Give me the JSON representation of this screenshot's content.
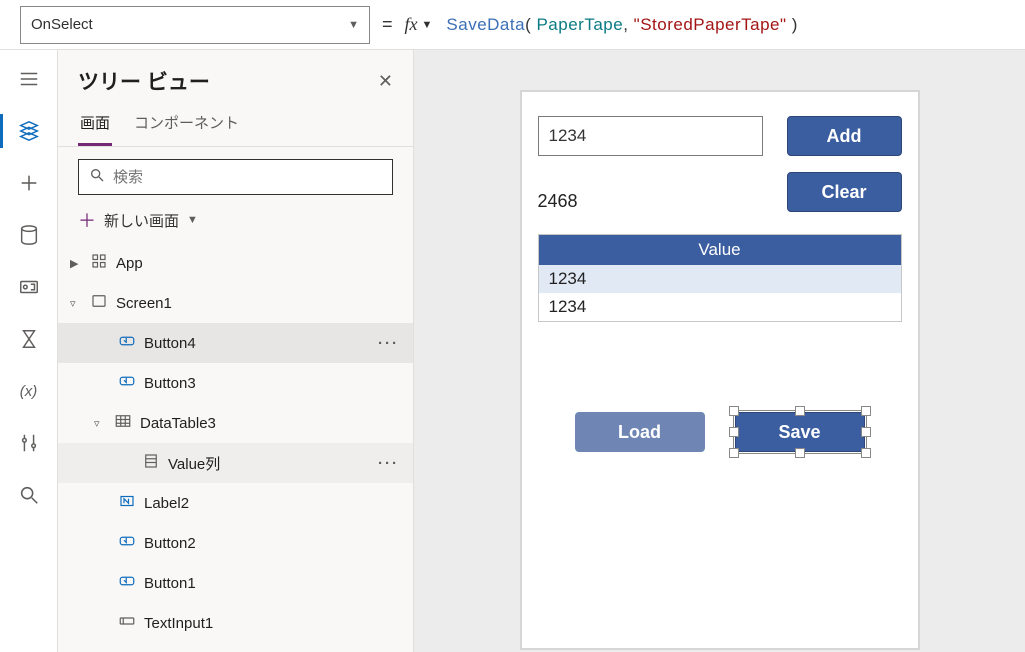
{
  "topbar": {
    "property": "OnSelect",
    "equals": "=",
    "fx": "fx",
    "formula_fn": "SaveData",
    "formula_ident": "PaperTape",
    "formula_str": "\"StoredPaperTape\""
  },
  "treePane": {
    "title": "ツリー ビュー",
    "tabs": {
      "screens": "画面",
      "components": "コンポーネント"
    },
    "search_placeholder": "検索",
    "new_screen": "新しい画面",
    "items": {
      "app": "App",
      "screen1": "Screen1",
      "button4": "Button4",
      "button3": "Button3",
      "datatable3": "DataTable3",
      "valuecol": "Value列",
      "label2": "Label2",
      "button2": "Button2",
      "button1": "Button1",
      "textinput1": "TextInput1"
    }
  },
  "rail": {
    "hamburger": "hamburger-icon",
    "tree": "tree-icon",
    "insert": "plus-icon",
    "data": "database-icon",
    "media": "media-icon",
    "advanced": "advanced-icon",
    "variables": "(x)",
    "tools": "tools-icon",
    "search": "search-icon"
  },
  "canvas": {
    "input_value": "1234",
    "add_btn": "Add",
    "sum_value": "2468",
    "clear_btn": "Clear",
    "table_header": "Value",
    "rows": [
      "1234",
      "1234"
    ],
    "load_btn": "Load",
    "save_btn": "Save"
  }
}
